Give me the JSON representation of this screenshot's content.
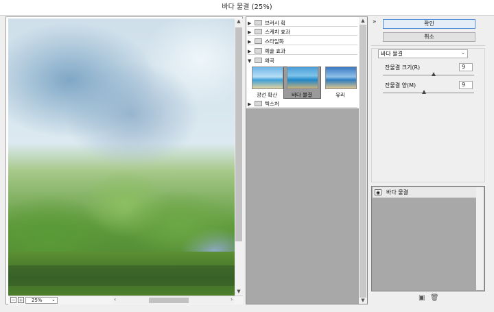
{
  "window": {
    "title": "바다 물결 (25%)"
  },
  "preview": {
    "zoom_value": "25%",
    "zoom_out_icon": "minus-icon",
    "zoom_in_icon": "plus-icon"
  },
  "gallery": {
    "categories_top": [
      {
        "label": "브러시 획",
        "expanded": false
      },
      {
        "label": "스케치 효과",
        "expanded": false
      },
      {
        "label": "스타일화",
        "expanded": false
      },
      {
        "label": "예술 효과",
        "expanded": false
      },
      {
        "label": "왜곡",
        "expanded": true
      }
    ],
    "distort_filters": [
      {
        "label": "광선 확산",
        "selected": false
      },
      {
        "label": "바다 물결",
        "selected": true
      },
      {
        "label": "유리",
        "selected": false
      }
    ],
    "categories_bottom": [
      {
        "label": "텍스처",
        "expanded": false
      }
    ]
  },
  "controls": {
    "ok_label": "확인",
    "cancel_label": "취소",
    "filter_select": "바다 물결",
    "params": [
      {
        "label": "잔물결 크기(R)",
        "value": "9",
        "slider_fraction": 0.53
      },
      {
        "label": "잔물결 양(M)",
        "value": "9",
        "slider_fraction": 0.43
      }
    ]
  },
  "layers": {
    "items": [
      {
        "label": "바다 물결",
        "visible": true
      }
    ]
  },
  "colors": {
    "accent": "#4a8fd8",
    "panel_gray": "#a8a8a8"
  }
}
